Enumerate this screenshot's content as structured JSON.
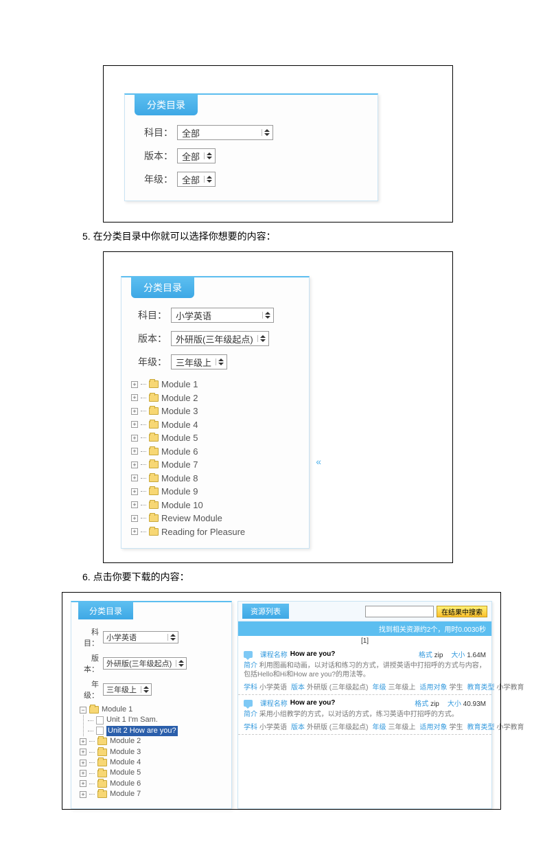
{
  "panel1": {
    "title": "分类目录",
    "rows": {
      "subject": {
        "label": "科目：",
        "value": "全部"
      },
      "edition": {
        "label": "版本：",
        "value": "全部"
      },
      "grade": {
        "label": "年级：",
        "value": "全部"
      }
    }
  },
  "step5": "5.   在分类目录中你就可以选择你想要的内容：",
  "panel2": {
    "title": "分类目录",
    "rows": {
      "subject": {
        "label": "科目：",
        "value": "小学英语"
      },
      "edition": {
        "label": "版本：",
        "value": "外研版(三年级起点)"
      },
      "grade": {
        "label": "年级：",
        "value": "三年级上"
      }
    },
    "tree": [
      "Module  1",
      "Module  2",
      "Module  3",
      "Module  4",
      "Module  5",
      "Module  6",
      "Module  7",
      "Module  8",
      "Module  9",
      "Module  10",
      "Review  Module",
      "Reading  for  Pleasure"
    ]
  },
  "step6": "6.   点击你要下载的内容：",
  "panel3": {
    "left": {
      "title": "分类目录",
      "rows": {
        "subject": {
          "label": "科目：",
          "value": "小学英语"
        },
        "edition": {
          "label": "版本：",
          "value": "外研版(三年级起点)"
        },
        "grade": {
          "label": "年级：",
          "value": "三年级上"
        }
      },
      "tree": {
        "module1": "Module  1",
        "unit1": "Unit  1  I'm  Sam.",
        "unit2": "Unit  2  How  are  you?",
        "rest": [
          "Module  2",
          "Module  3",
          "Module  4",
          "Module  5",
          "Module  6",
          "Module  7"
        ]
      }
    },
    "right": {
      "title": "资源列表",
      "searchBtn": "在结果中搜索",
      "resultBar": "找到相关资源约2个，用时0.0030秒",
      "pager": "[1]",
      "labels": {
        "courseName": "课程名称",
        "format": "格式",
        "size": "大小",
        "intro": "简介",
        "subject": "学科",
        "edition": "版本",
        "grade": "年级",
        "audience": "适用对象",
        "eduType": "教育类型"
      },
      "items": [
        {
          "title": "How are you?",
          "format": "zip",
          "size": "1.64M",
          "desc": "利用图画和动画，以对话和练习的方式，讲授英语中打招呼的方式与内容，包括Hello和Hi和How are you?的用法等。",
          "subject": "小学英语",
          "edition": "外研版 (三年级起点)",
          "grade": "三年级上",
          "audience": "学生",
          "eduType": "小学教育"
        },
        {
          "title": "How are you?",
          "format": "zip",
          "size": "40.93M",
          "desc": "采用小组教学的方式，以对话的方式，练习英语中打招呼的方式。",
          "subject": "小学英语",
          "edition": "外研版 (三年级起点)",
          "grade": "三年级上",
          "audience": "学生",
          "eduType": "小学教育"
        }
      ]
    }
  }
}
